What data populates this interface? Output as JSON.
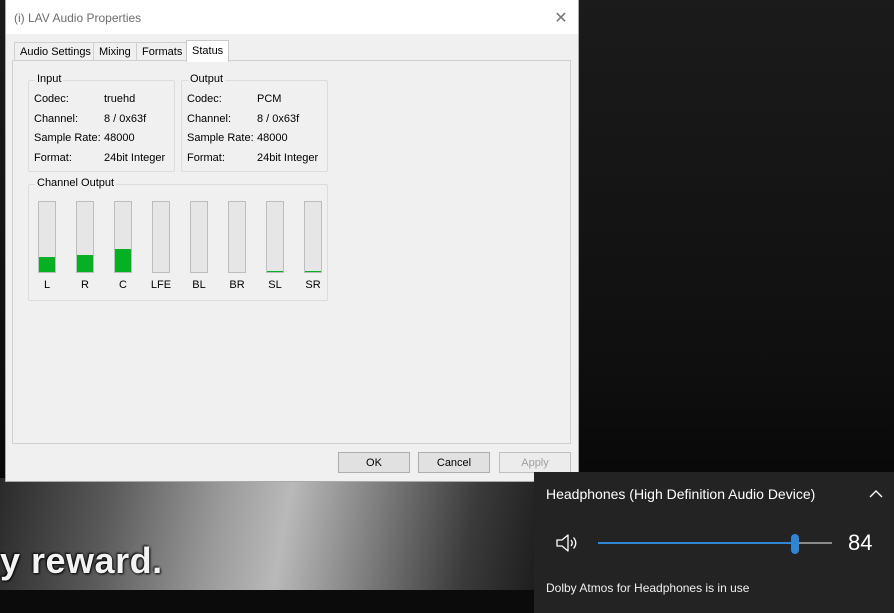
{
  "dialog": {
    "title": "(i) LAV Audio Properties",
    "close_glyph": "✕",
    "tabs": [
      {
        "label": "Audio Settings",
        "active": false
      },
      {
        "label": "Mixing",
        "active": false
      },
      {
        "label": "Formats",
        "active": false
      },
      {
        "label": "Status",
        "active": true
      }
    ],
    "input": {
      "title": "Input",
      "rows": [
        {
          "label": "Codec:",
          "value": "truehd"
        },
        {
          "label": "Channel:",
          "value": "8 / 0x63f"
        },
        {
          "label": "Sample Rate:",
          "value": "48000"
        },
        {
          "label": "Format:",
          "value": "24bit Integer"
        }
      ]
    },
    "output": {
      "title": "Output",
      "rows": [
        {
          "label": "Codec:",
          "value": "PCM"
        },
        {
          "label": "Channel:",
          "value": "8 / 0x63f"
        },
        {
          "label": "Sample Rate:",
          "value": "48000"
        },
        {
          "label": "Format:",
          "value": "24bit Integer"
        }
      ]
    },
    "channel_output": {
      "title": "Channel Output",
      "channels": [
        {
          "label": "L",
          "level": 0.21
        },
        {
          "label": "R",
          "level": 0.24
        },
        {
          "label": "C",
          "level": 0.33
        },
        {
          "label": "LFE",
          "level": 0.0
        },
        {
          "label": "BL",
          "level": 0.0
        },
        {
          "label": "BR",
          "level": 0.0
        },
        {
          "label": "SL",
          "level": 0.01
        },
        {
          "label": "SR",
          "level": 0.01
        }
      ],
      "meter_color": "#06b025"
    },
    "buttons": {
      "ok": "OK",
      "cancel": "Cancel",
      "apply": "Apply"
    }
  },
  "flyout": {
    "device_name": "Headphones (High Definition Audio Device)",
    "volume": 84,
    "volume_display": "84",
    "status_text": "Dolby Atmos for Headphones is in use",
    "accent_color": "#2f86d4"
  },
  "video": {
    "subtitle": "y reward."
  }
}
